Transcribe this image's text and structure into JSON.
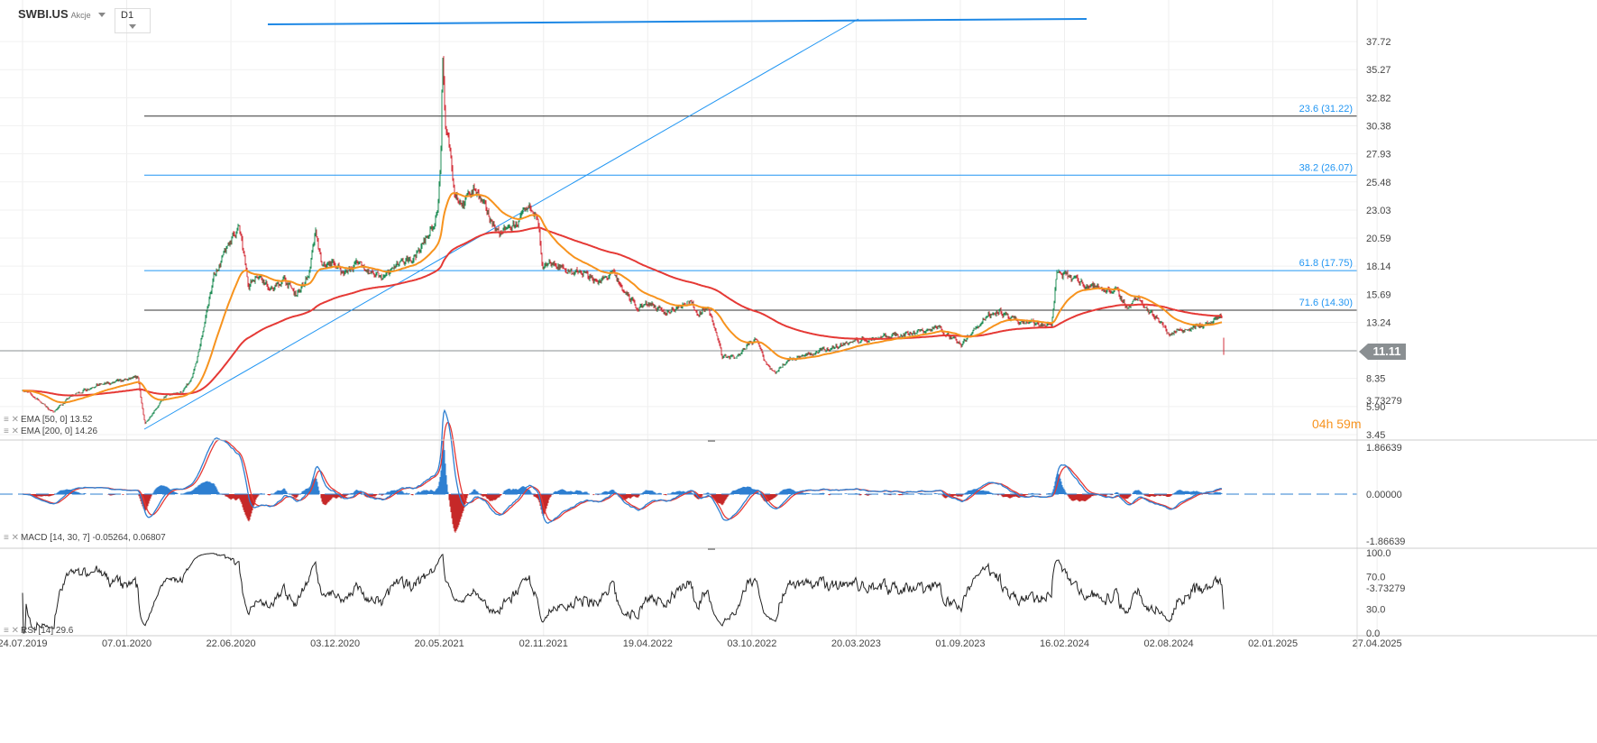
{
  "header": {
    "symbol": "SWBI.US",
    "asset_class": "Akcje",
    "timeframe": "D1"
  },
  "legend": {
    "ema50": "EMA [50, 0] 13.52",
    "ema200": "EMA [200, 0] 14.26",
    "macd": "MACD [14, 30, 7] -0.05264,  0.06807",
    "rsi": "RSI [14] 29.6"
  },
  "current_price": "11.11",
  "timer": {
    "hours": "04h",
    "minutes": "59m"
  },
  "colors": {
    "up": "#1e8c54",
    "down": "#d32f3a",
    "ema50": "#f7931e",
    "ema200": "#e53935",
    "fib": "#2196f3",
    "macd": "#2e7fd1",
    "signal": "#e53935"
  },
  "chart_data": {
    "type": "candlestick",
    "price_axis": [
      "37.72",
      "35.27",
      "32.82",
      "30.38",
      "27.93",
      "25.48",
      "23.03",
      "20.59",
      "18.14",
      "15.69",
      "13.24",
      "8.35",
      "5.90",
      "3.45"
    ],
    "macd_axis": [
      "3.73279",
      "1.86639",
      "0.00000",
      "-1.86639",
      "-3.73279"
    ],
    "rsi_axis": [
      "100.0",
      "70.0",
      "30.0",
      "0.0"
    ],
    "x_ticks": [
      "24.07.2019",
      "07.01.2020",
      "22.06.2020",
      "03.12.2020",
      "20.05.2021",
      "02.11.2021",
      "19.04.2022",
      "03.10.2022",
      "20.03.2023",
      "01.09.2023",
      "16.02.2024",
      "02.08.2024",
      "02.01.2025",
      "27.04.2025"
    ],
    "fib_levels": [
      {
        "label": "23.6 (31.22)",
        "price": 31.22,
        "color": "#333"
      },
      {
        "label": "38.2 (26.07)",
        "price": 26.07,
        "color": "#2196f3"
      },
      {
        "label": "61.8 (17.75)",
        "price": 17.75,
        "color": "#2196f3"
      },
      {
        "label": "71.6 (14.30)",
        "price": 14.3,
        "color": "#333"
      }
    ],
    "close_anchors": [
      [
        "2019-07-24",
        7.4
      ],
      [
        "2019-08-20",
        6.4
      ],
      [
        "2019-09-10",
        5.4
      ],
      [
        "2019-10-10",
        6.8
      ],
      [
        "2019-11-15",
        7.7
      ],
      [
        "2019-12-20",
        8.0
      ],
      [
        "2020-01-25",
        8.4
      ],
      [
        "2020-02-05",
        4.3
      ],
      [
        "2020-02-20",
        5.6
      ],
      [
        "2020-03-10",
        6.8
      ],
      [
        "2020-04-05",
        7.2
      ],
      [
        "2020-04-20",
        8.2
      ],
      [
        "2020-05-01",
        10.5
      ],
      [
        "2020-05-15",
        14.5
      ],
      [
        "2020-05-27",
        17.5
      ],
      [
        "2020-06-10",
        19.0
      ],
      [
        "2020-06-22",
        20.5
      ],
      [
        "2020-07-05",
        21.5
      ],
      [
        "2020-07-20",
        16.5
      ],
      [
        "2020-08-05",
        17.5
      ],
      [
        "2020-08-25",
        16.0
      ],
      [
        "2020-09-15",
        17.0
      ],
      [
        "2020-10-05",
        15.5
      ],
      [
        "2020-10-25",
        17.5
      ],
      [
        "2020-11-05",
        21.0
      ],
      [
        "2020-11-15",
        18.0
      ],
      [
        "2020-12-03",
        18.5
      ],
      [
        "2020-12-20",
        17.5
      ],
      [
        "2021-01-10",
        18.5
      ],
      [
        "2021-02-01",
        17.5
      ],
      [
        "2021-02-20",
        17.0
      ],
      [
        "2021-03-10",
        18.0
      ],
      [
        "2021-04-01",
        18.5
      ],
      [
        "2021-04-20",
        19.5
      ],
      [
        "2021-05-05",
        21.0
      ],
      [
        "2021-05-18",
        22.5
      ],
      [
        "2021-05-24",
        27.0
      ],
      [
        "2021-05-27",
        36.0
      ],
      [
        "2021-06-01",
        30.0
      ],
      [
        "2021-06-08",
        28.5
      ],
      [
        "2021-06-15",
        24.5
      ],
      [
        "2021-07-01",
        23.5
      ],
      [
        "2021-07-15",
        25.0
      ],
      [
        "2021-08-05",
        23.0
      ],
      [
        "2021-08-25",
        21.0
      ],
      [
        "2021-09-15",
        21.5
      ],
      [
        "2021-10-05",
        22.5
      ],
      [
        "2021-10-18",
        23.5
      ],
      [
        "2021-10-28",
        21.5
      ],
      [
        "2021-11-03",
        17.5
      ],
      [
        "2021-11-15",
        18.5
      ],
      [
        "2021-12-10",
        17.8
      ],
      [
        "2022-01-05",
        17.5
      ],
      [
        "2022-02-05",
        16.8
      ],
      [
        "2022-02-25",
        17.5
      ],
      [
        "2022-03-15",
        15.8
      ],
      [
        "2022-04-05",
        14.5
      ],
      [
        "2022-04-25",
        15.0
      ],
      [
        "2022-05-15",
        14.0
      ],
      [
        "2022-06-05",
        14.5
      ],
      [
        "2022-06-25",
        15.2
      ],
      [
        "2022-07-10",
        14.0
      ],
      [
        "2022-07-25",
        14.5
      ],
      [
        "2022-08-05",
        13.0
      ],
      [
        "2022-08-18",
        10.3
      ],
      [
        "2022-09-15",
        10.2
      ],
      [
        "2022-10-01",
        11.5
      ],
      [
        "2022-10-15",
        11.6
      ],
      [
        "2022-10-25",
        10.0
      ],
      [
        "2022-11-10",
        8.8
      ],
      [
        "2022-12-01",
        10.0
      ],
      [
        "2023-01-10",
        10.5
      ],
      [
        "2023-02-10",
        11.0
      ],
      [
        "2023-03-10",
        11.5
      ],
      [
        "2023-04-10",
        11.8
      ],
      [
        "2023-05-10",
        12.0
      ],
      [
        "2023-06-10",
        12.3
      ],
      [
        "2023-07-10",
        12.5
      ],
      [
        "2023-08-01",
        12.8
      ],
      [
        "2023-08-20",
        12.0
      ],
      [
        "2023-09-05",
        11.2
      ],
      [
        "2023-09-25",
        12.5
      ],
      [
        "2023-10-15",
        13.8
      ],
      [
        "2023-11-05",
        14.3
      ],
      [
        "2023-11-20",
        13.5
      ],
      [
        "2023-12-10",
        13.3
      ],
      [
        "2024-01-10",
        13.0
      ],
      [
        "2024-01-28",
        13.0
      ],
      [
        "2024-02-05",
        17.5
      ],
      [
        "2024-03-05",
        17.0
      ],
      [
        "2024-03-25",
        16.5
      ],
      [
        "2024-04-15",
        16.2
      ],
      [
        "2024-05-10",
        16.0
      ],
      [
        "2024-05-30",
        14.5
      ],
      [
        "2024-06-15",
        15.5
      ],
      [
        "2024-07-05",
        14.0
      ],
      [
        "2024-07-20",
        13.5
      ],
      [
        "2024-08-01",
        12.2
      ],
      [
        "2024-08-20",
        12.6
      ],
      [
        "2024-09-10",
        12.8
      ],
      [
        "2024-09-30",
        13.0
      ],
      [
        "2024-10-15",
        13.3
      ],
      [
        "2024-10-27",
        13.8
      ]
    ],
    "last_close": 11.11
  }
}
